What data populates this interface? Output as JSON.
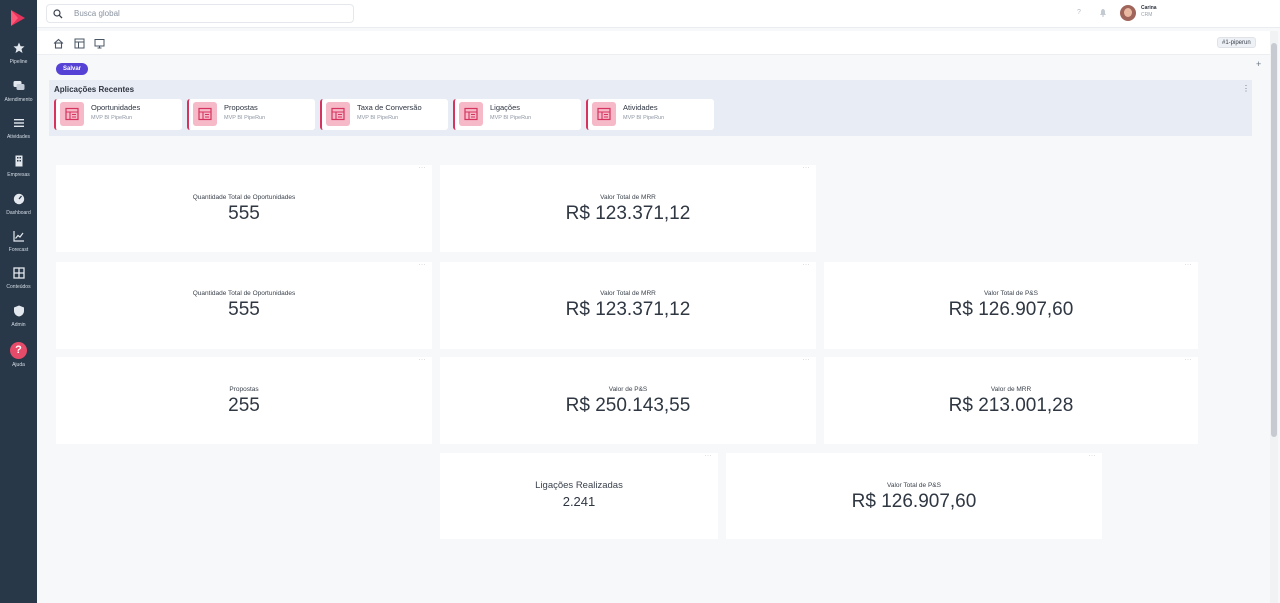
{
  "sidebar": {
    "items": [
      {
        "label": "Pipeline",
        "icon": "star-icon"
      },
      {
        "label": "Atendimento",
        "icon": "chat-icon"
      },
      {
        "label": "Atividades",
        "icon": "list-icon"
      },
      {
        "label": "Empresas",
        "icon": "building-icon"
      },
      {
        "label": "Dashboard",
        "icon": "gauge-icon"
      },
      {
        "label": "Forecast",
        "icon": "chart-line-icon"
      },
      {
        "label": "Conteúdos",
        "icon": "grid-icon"
      },
      {
        "label": "Admin",
        "icon": "shield-icon"
      },
      {
        "label": "Ajuda",
        "icon": "help-icon"
      }
    ]
  },
  "topbar": {
    "search_placeholder": "Busca global",
    "help_glyph": "?",
    "user_name": "Carina",
    "user_role": "CRM"
  },
  "toolbar": {
    "tag": "#1-piperun",
    "save_label": "Salvar",
    "add_glyph": "+"
  },
  "recent": {
    "title": "Aplicações Recentes",
    "more_glyph": "⋮",
    "apps": [
      {
        "name": "Oportunidades",
        "sub": "MVP BI PipeRun"
      },
      {
        "name": "Propostas",
        "sub": "MVP BI PipeRun"
      },
      {
        "name": "Taxa de Conversão",
        "sub": "MVP BI PipeRun"
      },
      {
        "name": "Ligações",
        "sub": "MVP BI PipeRun"
      },
      {
        "name": "Atividades",
        "sub": "MVP BI PipeRun"
      }
    ]
  },
  "widgets": [
    {
      "label": "Quantidade Total de Oportunidades",
      "value": "555"
    },
    {
      "label": "Valor Total de MRR",
      "value": "R$ 123.371,12"
    },
    {
      "label": "Quantidade Total de Oportunidades",
      "value": "555"
    },
    {
      "label": "Valor Total de MRR",
      "value": "R$ 123.371,12"
    },
    {
      "label": "Valor Total de P&S",
      "value": "R$ 126.907,60"
    },
    {
      "label": "Propostas",
      "value": "255"
    },
    {
      "label": "Valor de P&S",
      "value": "R$ 250.143,55"
    },
    {
      "label": "Valor de MRR",
      "value": "R$ 213.001,28"
    },
    {
      "label": "Ligações Realizadas",
      "value": "2.241"
    },
    {
      "label": "Valor Total de P&S",
      "value": "R$ 126.907,60"
    }
  ],
  "widget_more_glyph": "···",
  "colors": {
    "sidebar": "#283848",
    "accent": "#5643d6",
    "brand": "#e64b6a"
  }
}
